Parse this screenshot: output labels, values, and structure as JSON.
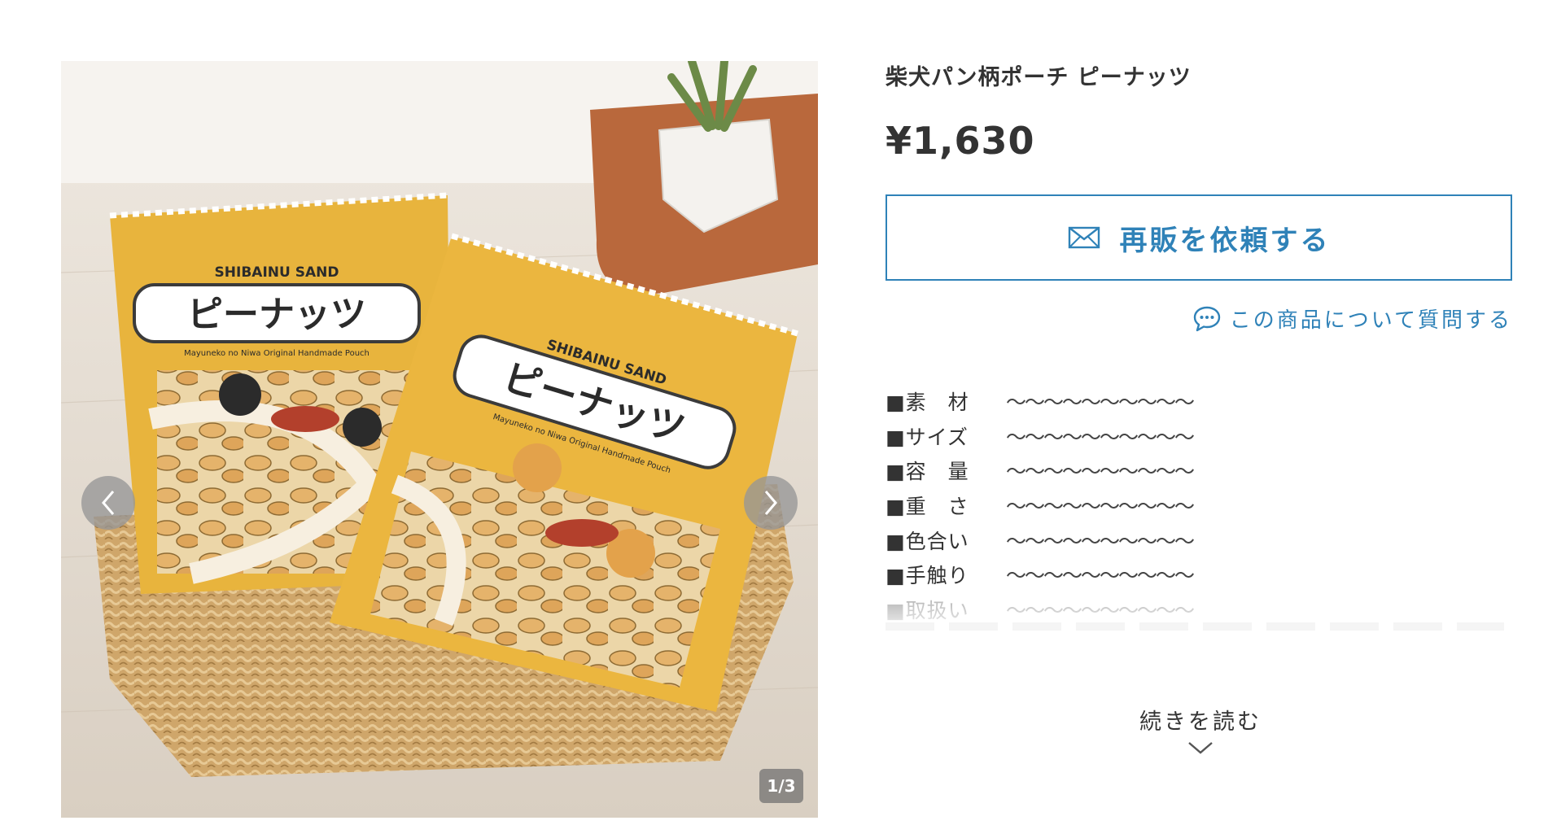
{
  "gallery": {
    "counter": "1/3",
    "prev_icon": "chevron-left-icon",
    "next_icon": "chevron-right-icon",
    "photo_text": {
      "brand": "SHIBAINU SAND",
      "product": "ピーナッツ",
      "subtitle": "Mayuneko no Niwa Original Handmade Pouch"
    }
  },
  "product": {
    "title": "柴犬パン柄ポーチ ピーナッツ",
    "price": "¥1,630",
    "rerequest_label": "再販を依頼する",
    "rerequest_icon": "envelope-icon",
    "ask_label": "この商品について質問する",
    "ask_icon": "chat-bubble-icon",
    "accent_color": "#2f82b8"
  },
  "specs": [
    {
      "key": "■素　材",
      "value": "〜〜〜〜〜〜〜〜〜〜"
    },
    {
      "key": "■サイズ",
      "value": "〜〜〜〜〜〜〜〜〜〜"
    },
    {
      "key": "■容　量",
      "value": "〜〜〜〜〜〜〜〜〜〜"
    },
    {
      "key": "■重　さ",
      "value": "〜〜〜〜〜〜〜〜〜〜"
    },
    {
      "key": "■色合い",
      "value": "〜〜〜〜〜〜〜〜〜〜"
    },
    {
      "key": "■手触り",
      "value": "〜〜〜〜〜〜〜〜〜〜"
    },
    {
      "key": "■取扱い",
      "value": "〜〜〜〜〜〜〜〜〜〜"
    }
  ],
  "read_more": {
    "label": "続きを読む",
    "icon": "chevron-down-icon"
  }
}
